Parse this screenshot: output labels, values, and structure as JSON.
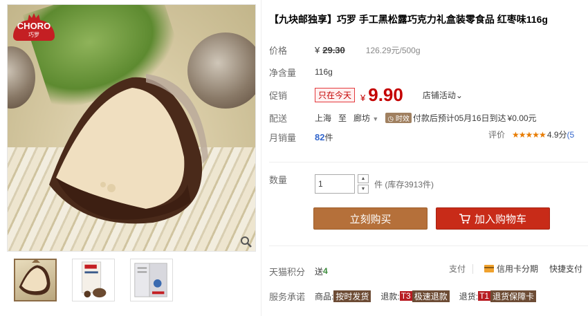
{
  "brand": {
    "logo_text": "CHORO",
    "logo_sub": "巧罗"
  },
  "product": {
    "title": "【九块邮独享】巧罗 手工黑松露巧克力礼盒装零食品 红枣味116g"
  },
  "price": {
    "label": "价格",
    "currency": "¥",
    "original": "29.30",
    "unit_price": "126.29元/500g"
  },
  "weight": {
    "label": "净含量",
    "value": "116g"
  },
  "promo": {
    "label": "促销",
    "tag": "只在今天",
    "currency": "¥",
    "price": "9.90",
    "shop_activity": "店铺活动"
  },
  "shipping": {
    "label": "配送",
    "from": "上海",
    "to_word": "至",
    "to_city": "廊坊",
    "badge": "时效",
    "eta": "付款后预计05月16日到达",
    "fee": "¥0.00元"
  },
  "sales": {
    "label": "月销量",
    "count": "82",
    "unit": "件"
  },
  "rating": {
    "label": "评价",
    "stars": "★★★★★",
    "score": "4.9分",
    "more": "(5"
  },
  "quantity": {
    "label": "数量",
    "value": "1",
    "up": "▲",
    "down": "▼",
    "stock": "件 (库存3913件)"
  },
  "buttons": {
    "buy_now": "立刻购买",
    "add_cart": "加入购物车"
  },
  "points": {
    "label": "天猫积分",
    "prefix": "送",
    "value": "4"
  },
  "payment": {
    "label": "支付",
    "card": "信用卡分期",
    "quick": "快捷支付"
  },
  "services": {
    "label": "服务承诺",
    "items": [
      {
        "prefix": "商品:",
        "code": "",
        "tag": "按时发货"
      },
      {
        "prefix": "退款:",
        "code": "T3",
        "tag": "极速退款"
      },
      {
        "prefix": "退货:",
        "code": "T1",
        "tag": "退货保障卡"
      }
    ]
  }
}
